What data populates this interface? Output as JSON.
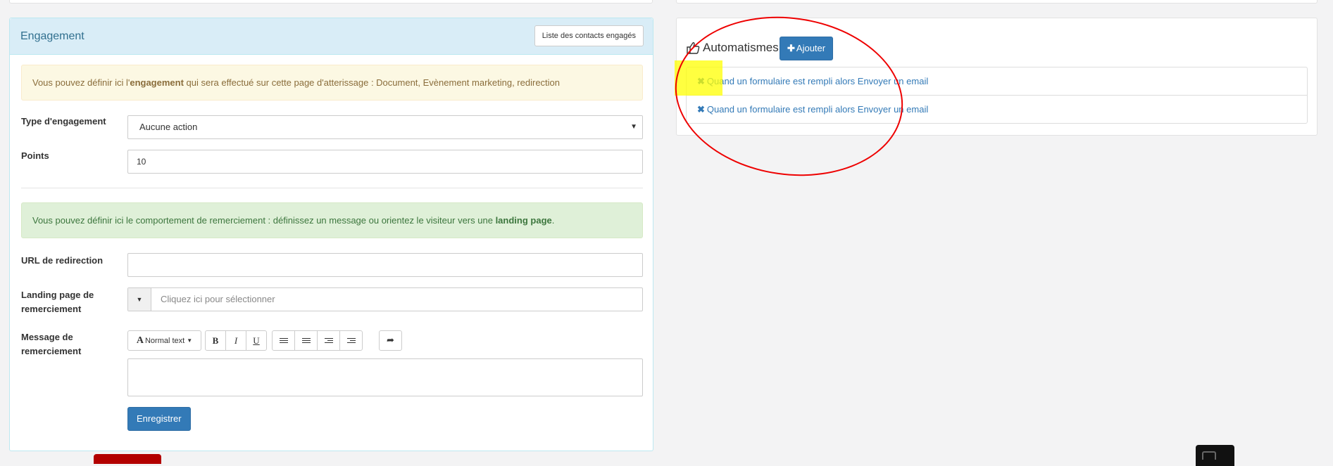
{
  "engagement": {
    "title": "Engagement",
    "contacts_button": "Liste des contacts engagés",
    "info_warning_pre": "Vous pouvez définir ici l'",
    "info_warning_bold": "engagement",
    "info_warning_post": " qui sera effectué sur cette page d'atterissage : Document, Evènement marketing, redirection",
    "type_label": "Type d'engagement",
    "type_value": "Aucune action",
    "points_label": "Points",
    "points_value": "10",
    "info_success_pre": "Vous pouvez définir ici le comportement de remerciement : définissez un message ou orientez le visiteur vers une ",
    "info_success_bold": "landing page",
    "info_success_post": ".",
    "redirect_label": "URL de redirection",
    "redirect_value": "",
    "landing_label": "Landing page de remerciement",
    "landing_placeholder": "Cliquez ici pour sélectionner",
    "message_label": "Message de remerciement",
    "toolbar": {
      "text_style": "Normal text",
      "bold": "B",
      "italic": "I",
      "underline": "U"
    },
    "save_button": "Enregistrer"
  },
  "automations": {
    "title": "Automatismes",
    "add_button": "Ajouter",
    "items": [
      {
        "label": "Quand un formulaire est rempli alors Envoyer un email"
      },
      {
        "label": "Quand un formulaire est rempli alors Envoyer un email"
      }
    ]
  },
  "colors": {
    "primary": "#337ab7",
    "info_bg": "#d9edf7",
    "warning_bg": "#fcf8e3",
    "success_bg": "#dff0d8",
    "annotation_red": "#ee0000",
    "annotation_yellow": "#ffff00"
  }
}
